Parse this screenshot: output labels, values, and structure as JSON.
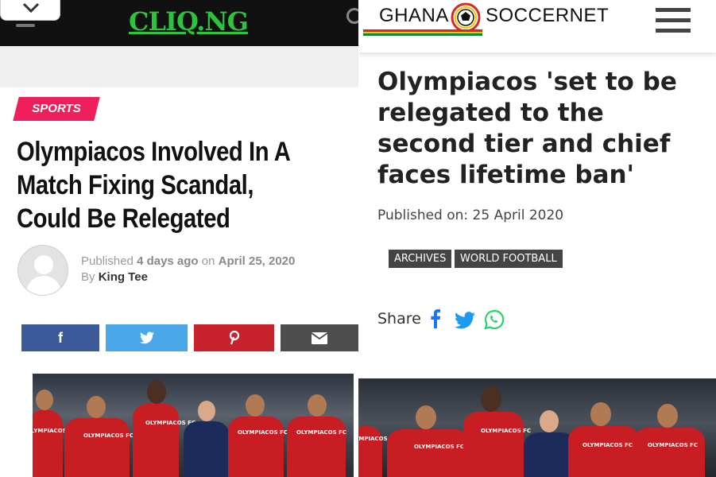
{
  "left": {
    "logo": "CLIQ.NG",
    "tag": "SPORTS",
    "title": "Olympiacos Involved In A Match Fixing Scandal, Could Be Relegated",
    "meta": {
      "published_prefix": "Published",
      "age": "4 days ago",
      "on": "on",
      "date": "April 25, 2020",
      "by": "By",
      "author": "King Tee"
    },
    "share_buttons": [
      {
        "name": "facebook",
        "glyph": "f",
        "color": "#3b5998"
      },
      {
        "name": "twitter",
        "glyph": "twitter-bird-icon",
        "color": "#4aa8e8"
      },
      {
        "name": "pinterest",
        "glyph": "pinterest-icon",
        "color": "#c8232c"
      },
      {
        "name": "email",
        "glyph": "envelope-icon",
        "color": "#4d4d4d"
      }
    ],
    "photo_jersey_text": "OLYMPIACOS FC"
  },
  "right": {
    "logo_left": "GHANA",
    "logo_right": "SOCCERNET",
    "title": "Olympiacos 'set to be relegated to the second tier and chief faces lifetime ban'",
    "published": "Published on: 25 April 2020",
    "tags": [
      "ARCHIVES",
      "WORLD FOOTBALL"
    ],
    "share_label": "Share",
    "share_icons": [
      "facebook-icon",
      "twitter-icon",
      "whatsapp-icon"
    ],
    "photo_jersey_text": "OLYMPIACOS FC"
  }
}
